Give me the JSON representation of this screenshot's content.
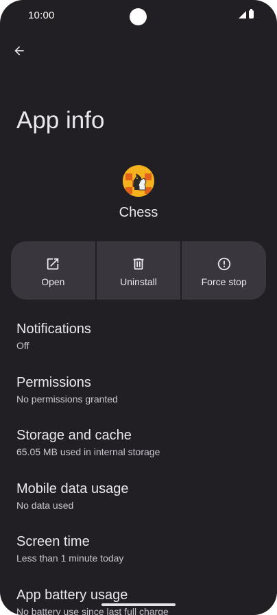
{
  "status_bar": {
    "time": "10:00",
    "icons": [
      "signal-icon",
      "battery-icon"
    ]
  },
  "header": {
    "back_icon": "arrow-left-icon",
    "title": "App info"
  },
  "app": {
    "name": "Chess",
    "icon": "chess-knight-icon"
  },
  "actions": [
    {
      "label": "Open",
      "icon": "open-external-icon"
    },
    {
      "label": "Uninstall",
      "icon": "trash-icon"
    },
    {
      "label": "Force stop",
      "icon": "alert-circle-icon"
    }
  ],
  "settings": [
    {
      "title": "Notifications",
      "summary": "Off"
    },
    {
      "title": "Permissions",
      "summary": "No permissions granted"
    },
    {
      "title": "Storage and cache",
      "summary": "65.05 MB used in internal storage"
    },
    {
      "title": "Mobile data usage",
      "summary": "No data used"
    },
    {
      "title": "Screen time",
      "summary": "Less than 1 minute today"
    },
    {
      "title": "App battery usage",
      "summary": "No battery use since last full charge"
    }
  ],
  "colors": {
    "background": "#221f24",
    "surface": "#3a363d",
    "text_primary": "#ece6ee",
    "text_secondary": "#cac4cf",
    "app_icon_bg": "#f5b11e"
  }
}
